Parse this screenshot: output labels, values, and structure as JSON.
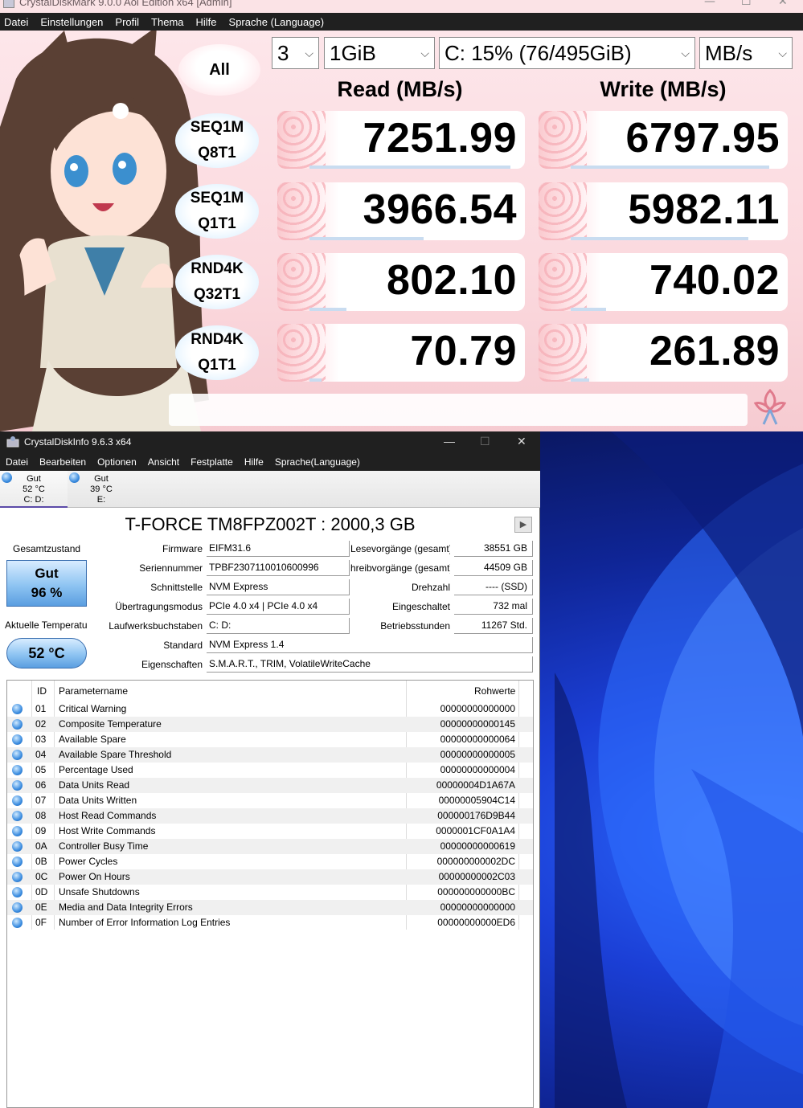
{
  "cdm": {
    "title": "CrystalDiskMark 9.0.0 Aoi Edition x64 [Admin]",
    "menu": [
      "Datei",
      "Einstellungen",
      "Profil",
      "Thema",
      "Hilfe",
      "Sprache (Language)"
    ],
    "all_label": "All",
    "count": "3",
    "size": "1GiB",
    "drive": "C: 15% (76/495GiB)",
    "unit": "MB/s",
    "read_header": "Read (MB/s)",
    "write_header": "Write (MB/s)",
    "rows": [
      {
        "l1": "SEQ1M",
        "l2": "Q8T1",
        "read": "7251.99",
        "write": "6797.95"
      },
      {
        "l1": "SEQ1M",
        "l2": "Q1T1",
        "read": "3966.54",
        "write": "5982.11"
      },
      {
        "l1": "RND4K",
        "l2": "Q32T1",
        "read": "802.10",
        "write": "740.02"
      },
      {
        "l1": "RND4K",
        "l2": "Q1T1",
        "read": "70.79",
        "write": "261.89"
      }
    ],
    "bars": {
      "read": [
        0.97,
        0.55,
        0.18,
        0.06
      ],
      "write": [
        0.95,
        0.85,
        0.17,
        0.09
      ]
    }
  },
  "cdi": {
    "title": "CrystalDiskInfo 9.6.3 x64",
    "menu": [
      "Datei",
      "Bearbeiten",
      "Optionen",
      "Ansicht",
      "Festplatte",
      "Hilfe",
      "Sprache(Language)"
    ],
    "drives": [
      {
        "status": "Gut",
        "temp": "52 °C",
        "letter": "C: D:"
      },
      {
        "status": "Gut",
        "temp": "39 °C",
        "letter": "E:"
      }
    ],
    "drive_title": "T-FORCE TM8FPZ002T : 2000,3 GB",
    "health_label": "Gesamtzustand",
    "health_status": "Gut",
    "health_pct": "96 %",
    "temp_label": "Aktuelle Temperatu",
    "temp_value": "52 °C",
    "fields": {
      "firmware_l": "Firmware",
      "firmware": "EIFM31.6",
      "serial_l": "Seriennummer",
      "serial": "TPBF2307110010600996",
      "interface_l": "Schnittstelle",
      "interface": "NVM Express",
      "transfer_l": "Übertragungsmodus",
      "transfer": "PCIe 4.0 x4 | PCIe 4.0 x4",
      "letters_l": "Laufwerksbuchstaben",
      "letters": "C: D:",
      "standard_l": "Standard",
      "standard": "NVM Express 1.4",
      "features_l": "Eigenschaften",
      "features": "S.M.A.R.T., TRIM, VolatileWriteCache",
      "reads_l": "Lesevorgänge (gesamt)",
      "reads": "38551 GB",
      "writes_l": "hreibvorgänge (gesamt)",
      "writes": "44509 GB",
      "rpm_l": "Drehzahl",
      "rpm": "---- (SSD)",
      "poweron_l": "Eingeschaltet",
      "poweron": "732 mal",
      "hours_l": "Betriebsstunden",
      "hours": "11267 Std."
    },
    "smart_headers": {
      "id": "ID",
      "name": "Parametername",
      "raw": "Rohwerte"
    },
    "smart": [
      {
        "id": "01",
        "name": "Critical Warning",
        "raw": "00000000000000"
      },
      {
        "id": "02",
        "name": "Composite Temperature",
        "raw": "00000000000145"
      },
      {
        "id": "03",
        "name": "Available Spare",
        "raw": "00000000000064"
      },
      {
        "id": "04",
        "name": "Available Spare Threshold",
        "raw": "00000000000005"
      },
      {
        "id": "05",
        "name": "Percentage Used",
        "raw": "00000000000004"
      },
      {
        "id": "06",
        "name": "Data Units Read",
        "raw": "00000004D1A67A"
      },
      {
        "id": "07",
        "name": "Data Units Written",
        "raw": "00000005904C14"
      },
      {
        "id": "08",
        "name": "Host Read Commands",
        "raw": "000000176D9B44"
      },
      {
        "id": "09",
        "name": "Host Write Commands",
        "raw": "0000001CF0A1A4"
      },
      {
        "id": "0A",
        "name": "Controller Busy Time",
        "raw": "00000000000619"
      },
      {
        "id": "0B",
        "name": "Power Cycles",
        "raw": "000000000002DC"
      },
      {
        "id": "0C",
        "name": "Power On Hours",
        "raw": "00000000002C03"
      },
      {
        "id": "0D",
        "name": "Unsafe Shutdowns",
        "raw": "000000000000BC"
      },
      {
        "id": "0E",
        "name": "Media and Data Integrity Errors",
        "raw": "00000000000000"
      },
      {
        "id": "0F",
        "name": "Number of Error Information Log Entries",
        "raw": "00000000000ED6"
      }
    ]
  },
  "colors": {
    "cdm_bg": "#fbe3e6",
    "cdi_menubar": "#202020",
    "health_blue": "#8ec4f2",
    "desktop_blue": "#1b3fd6"
  }
}
